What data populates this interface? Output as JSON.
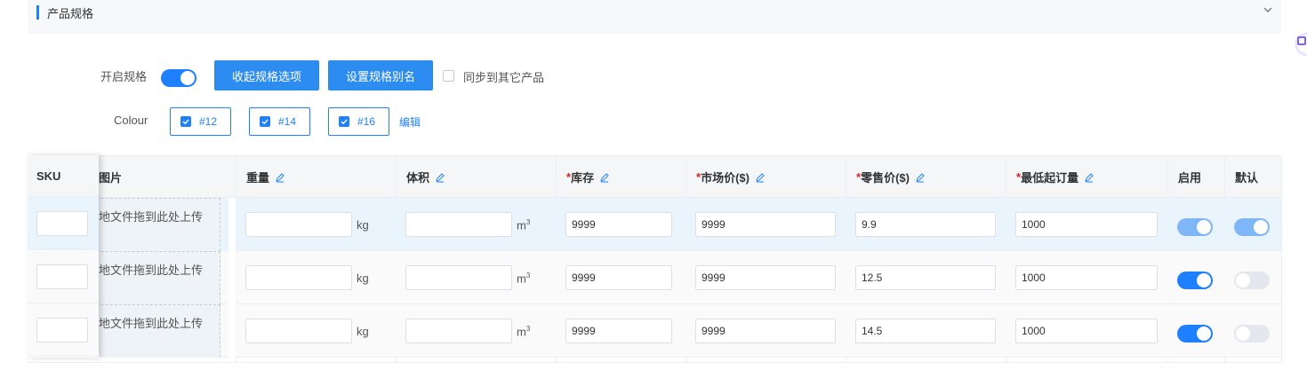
{
  "section": {
    "title": "产品规格"
  },
  "controls": {
    "enable_label": "开启规格",
    "enable_on": true,
    "collapse_button": "收起规格选项",
    "alias_button": "设置规格别名",
    "sync_label": "同步到其它产品",
    "sync_checked": false
  },
  "colour": {
    "label": "Colour",
    "options": [
      "#12",
      "#14",
      "#16"
    ],
    "edit_label": "编辑"
  },
  "table": {
    "headers": {
      "sku": "SKU",
      "image": "图片",
      "weight": "重量",
      "volume": "体积",
      "stock": "库存",
      "market_price": "市场价($)",
      "retail_price": "零售价($)",
      "moq": "最低起订量",
      "enabled": "启用",
      "default": "默认"
    },
    "required_mark": "*",
    "units": {
      "weight": "kg",
      "volume": "m",
      "volume_sup": "3"
    },
    "upload_text": "地文件拖到此处上传",
    "rows": [
      {
        "sku": "",
        "weight": "",
        "volume": "",
        "stock": "9999",
        "market_price": "9999",
        "retail_price": "9.9",
        "moq": "1000",
        "enabled": true,
        "default": true
      },
      {
        "sku": "",
        "weight": "",
        "volume": "",
        "stock": "9999",
        "market_price": "9999",
        "retail_price": "12.5",
        "moq": "1000",
        "enabled": true,
        "default": false
      },
      {
        "sku": "",
        "weight": "",
        "volume": "",
        "stock": "9999",
        "market_price": "9999",
        "retail_price": "14.5",
        "moq": "1000",
        "enabled": true,
        "default": false
      }
    ]
  },
  "colors": {
    "accent": "#1e80ff",
    "button": "#2d8cf0",
    "required": "#e02020"
  }
}
